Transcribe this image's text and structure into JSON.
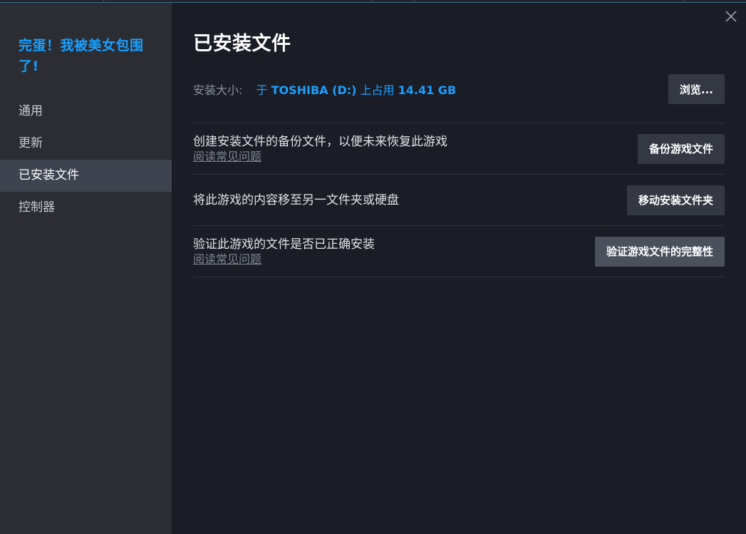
{
  "sidebar": {
    "game_title": "完蛋！我被美女包围了!",
    "items": [
      {
        "label": "通用",
        "active": false
      },
      {
        "label": "更新",
        "active": false
      },
      {
        "label": "已安装文件",
        "active": true
      },
      {
        "label": "控制器",
        "active": false
      }
    ]
  },
  "main": {
    "title": "已安装文件",
    "install_size": {
      "label": "安装大小:",
      "prefix": "于 ",
      "drive": "TOSHIBA (D:)",
      "middle": " 上占用 ",
      "size": "14.41 GB"
    },
    "browse_button": "浏览...",
    "rows": [
      {
        "text": "创建安装文件的备份文件，以便未来恢复此游戏",
        "link": "阅读常见问题",
        "button": "备份游戏文件"
      },
      {
        "text": "将此游戏的内容移至另一文件夹或硬盘",
        "link": "",
        "button": "移动安装文件夹"
      },
      {
        "text": "验证此游戏的文件是否已正确安装",
        "link": "阅读常见问题",
        "button": "验证游戏文件的完整性"
      }
    ]
  },
  "colors": {
    "accent": "#1a9fff",
    "sidebar_bg": "#2b2d33",
    "content_bg": "#1a1d26",
    "active_item_bg": "#3d4450",
    "button_bg": "#343842"
  },
  "icons": {
    "close": "close-icon"
  }
}
